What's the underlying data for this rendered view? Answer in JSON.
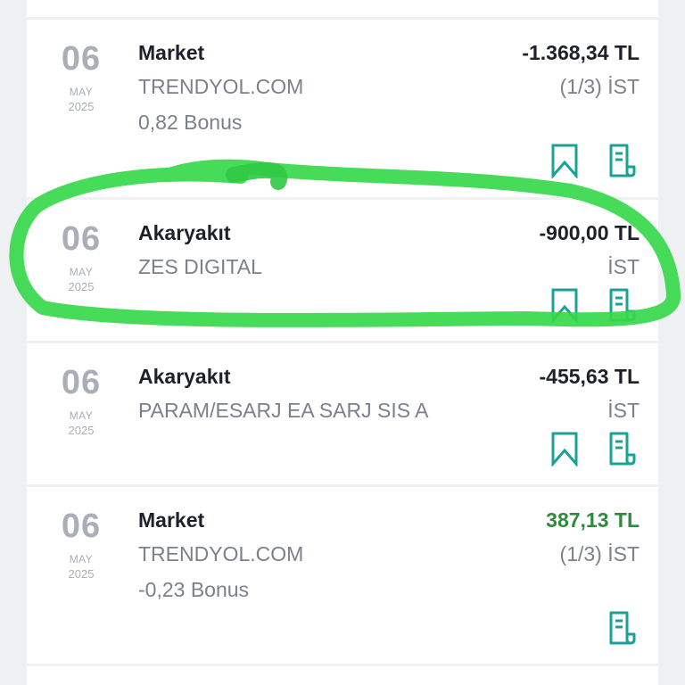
{
  "transactions": [
    {
      "day": "06",
      "month": "MAY",
      "year": "2025",
      "category": "Market",
      "merchant": "TRENDYOL.COM",
      "bonus": "0,82 Bonus",
      "amount": "-1.368,34 TL",
      "installment": "(1/3) İST"
    },
    {
      "day": "06",
      "month": "MAY",
      "year": "2025",
      "category": "Akaryakıt",
      "merchant": "ZES DIGITAL",
      "amount": "-900,00 TL",
      "installment": "İST"
    },
    {
      "day": "06",
      "month": "MAY",
      "year": "2025",
      "category": "Akaryakıt",
      "merchant": "PARAM/ESARJ EA SARJ SIS A",
      "amount": "-455,63 TL",
      "installment": "İST"
    },
    {
      "day": "06",
      "month": "MAY",
      "year": "2025",
      "category": "Market",
      "merchant": "TRENDYOL.COM",
      "bonus": "-0,23 Bonus",
      "amount": "387,13 TL",
      "installment": "(1/3) İST"
    }
  ],
  "icons": {
    "bookmark": "bookmark-icon",
    "receipt": "receipt-icon"
  },
  "colors": {
    "accent_teal": "#1aa394",
    "positive_amount": "#2f8a3e",
    "highlight_marker": "#36d84b"
  }
}
